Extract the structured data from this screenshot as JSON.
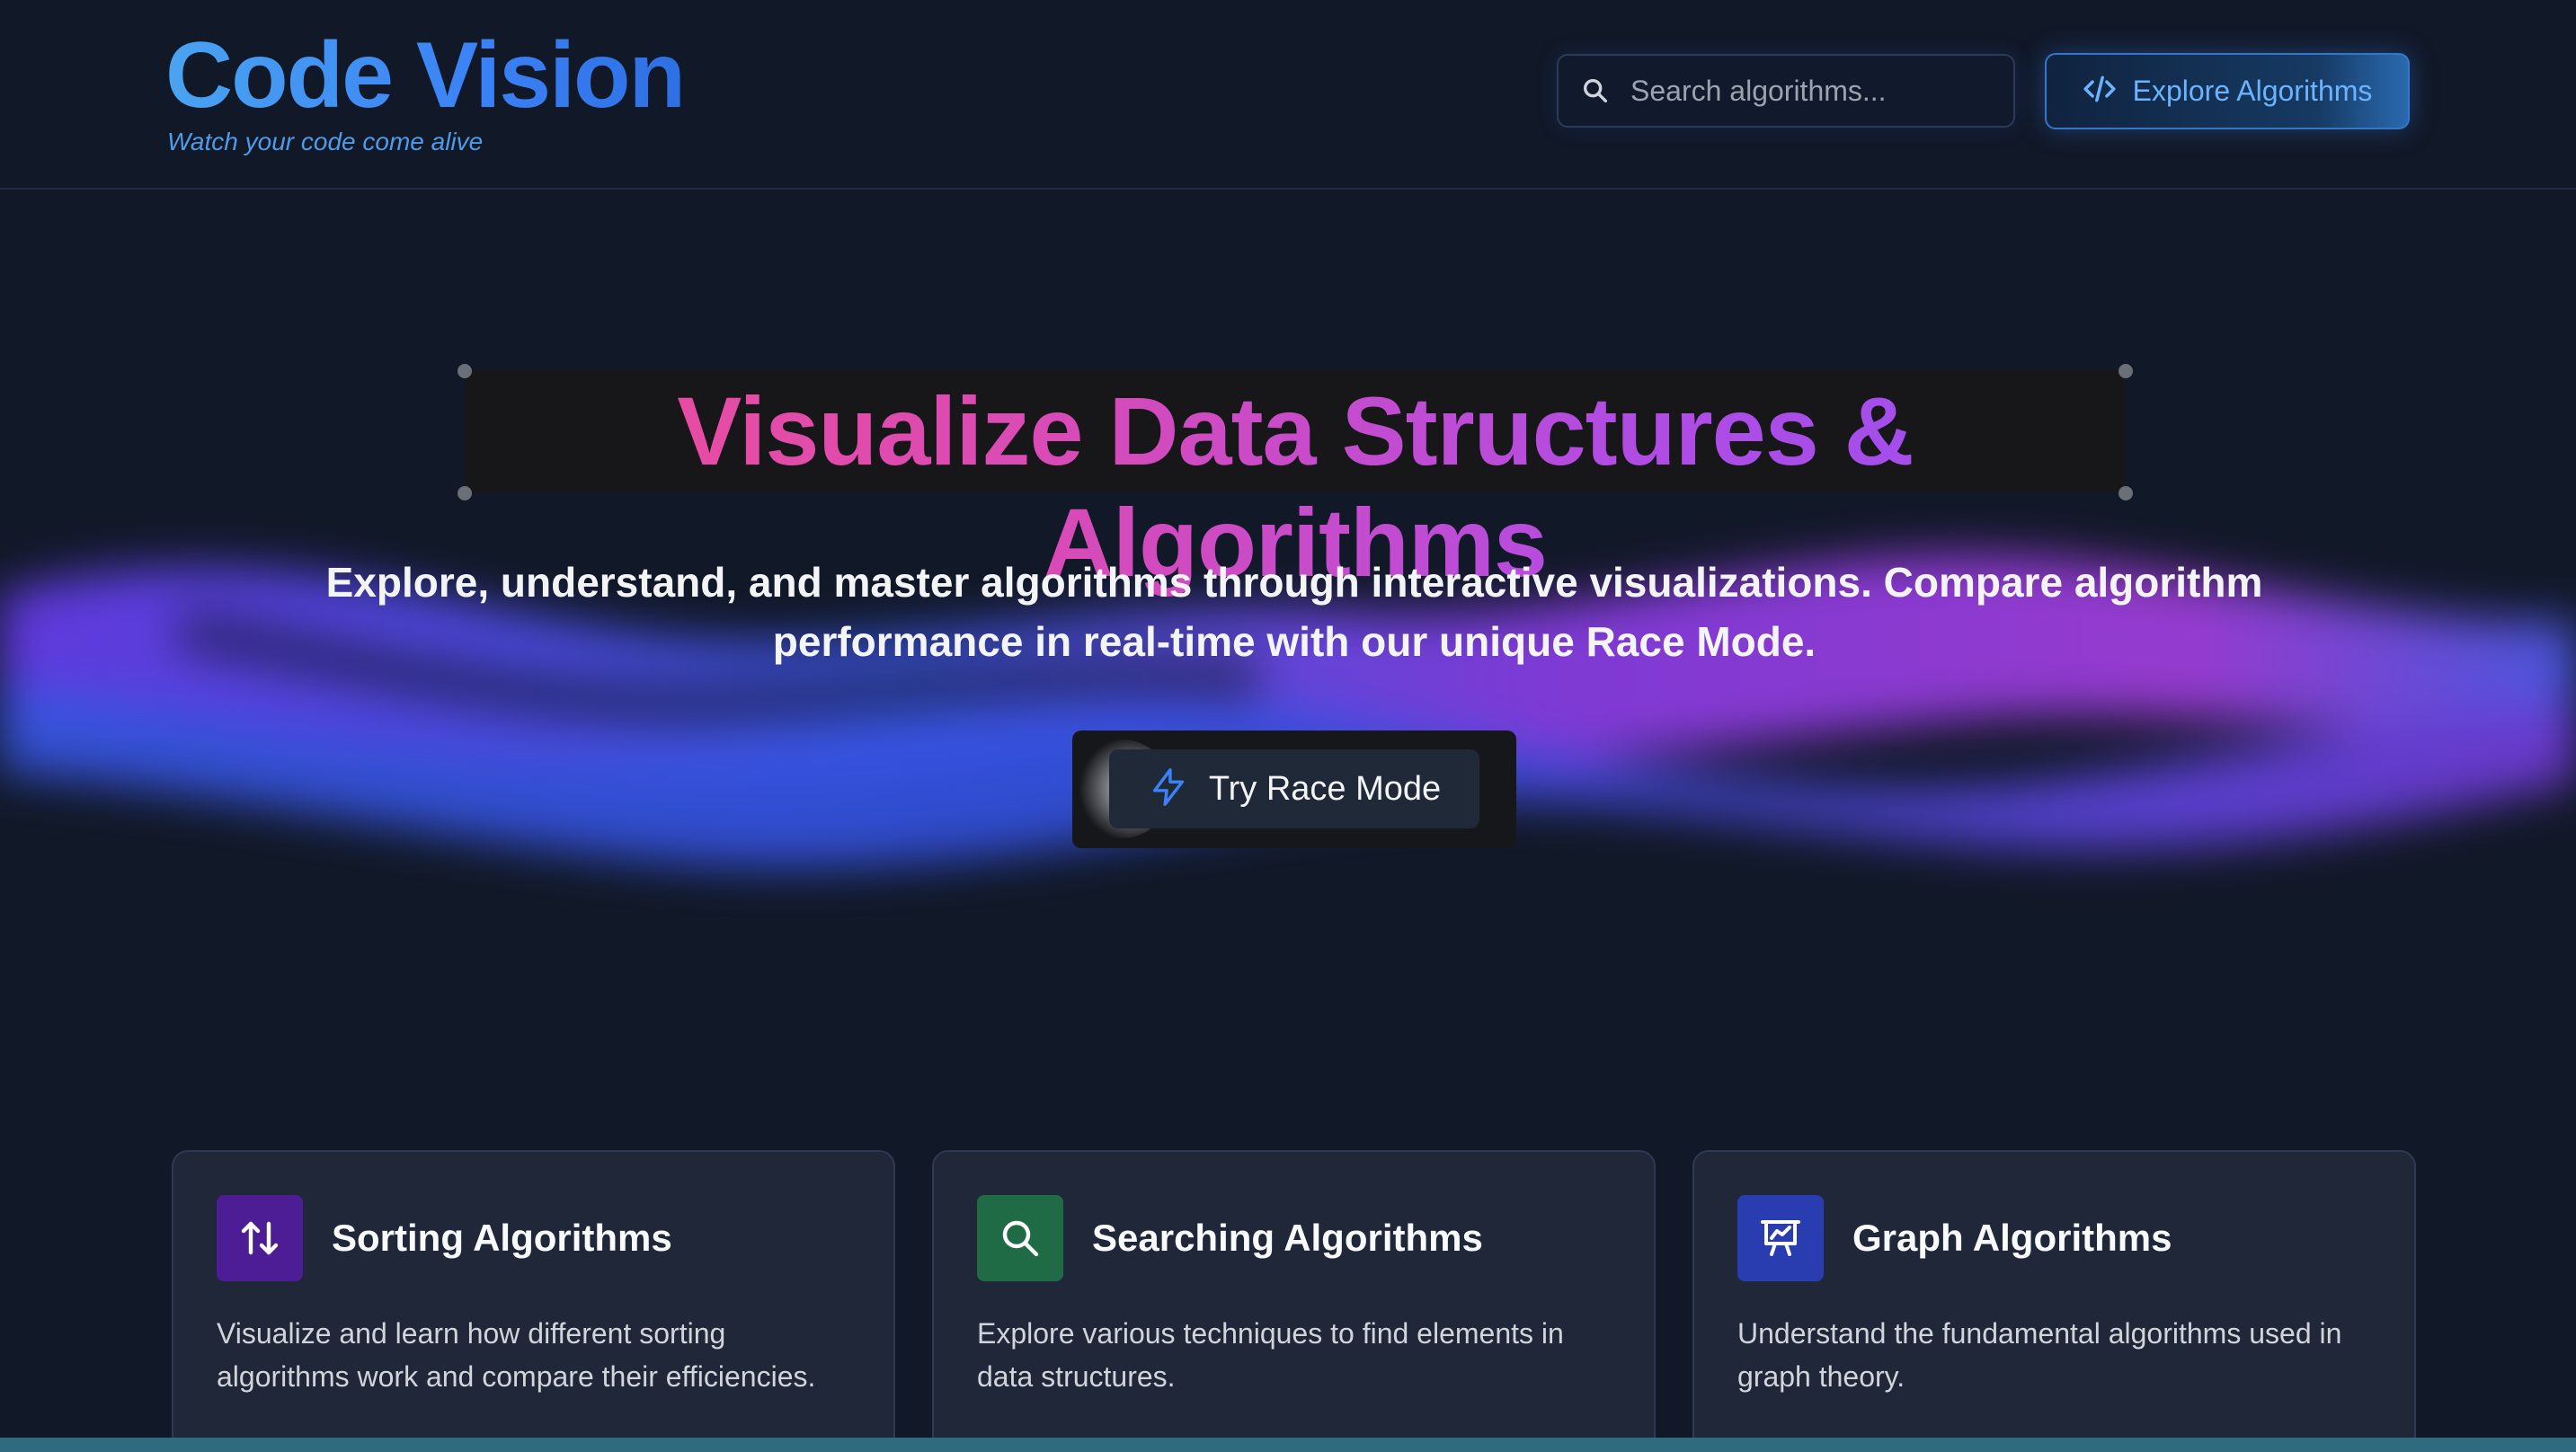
{
  "header": {
    "logo": "Code Vision",
    "tagline": "Watch your code come alive",
    "search": {
      "placeholder": "Search algorithms...",
      "value": ""
    },
    "explore_label": "Explore Algorithms"
  },
  "hero": {
    "title": "Visualize Data Structures & Algorithms",
    "subtitle_line1": "Explore, understand, and master algorithms through interactive visualizations. Compare algorithm",
    "subtitle_line2": "performance in real-time with our unique Race Mode.",
    "race_label": "Try Race Mode"
  },
  "cards": [
    {
      "title": "Sorting Algorithms",
      "description": "Visualize and learn how different sorting algorithms work and compare their efficiencies.",
      "icon": "arrows-up-down-icon",
      "icon_bg": "#4c1d95"
    },
    {
      "title": "Searching Algorithms",
      "description": "Explore various techniques to find elements in data structures.",
      "icon": "search-icon",
      "icon_bg": "#1f6b45"
    },
    {
      "title": "Graph Algorithms",
      "description": "Understand the fundamental algorithms used in graph theory.",
      "icon": "presentation-chart-icon",
      "icon_bg": "#2a3db0"
    }
  ],
  "colors": {
    "background": "#111827",
    "card_bg": "#1f2738",
    "accent_blue": "#3b82f6",
    "title_gradient_start": "#ee4c98",
    "title_gradient_end": "#9b4ff2"
  }
}
